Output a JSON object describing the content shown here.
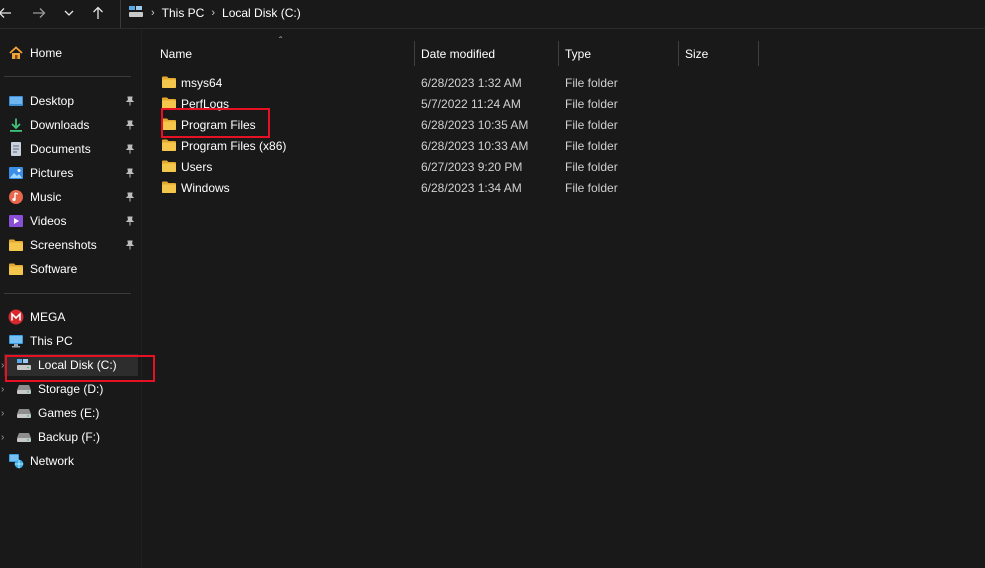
{
  "breadcrumb": [
    "This PC",
    "Local Disk (C:)"
  ],
  "sidebar": {
    "home": "Home",
    "quick_access": [
      {
        "label": "Desktop",
        "icon": "desktop-icon",
        "pinned": true
      },
      {
        "label": "Downloads",
        "icon": "downloads-icon",
        "pinned": true
      },
      {
        "label": "Documents",
        "icon": "documents-icon",
        "pinned": true
      },
      {
        "label": "Pictures",
        "icon": "pictures-icon",
        "pinned": true
      },
      {
        "label": "Music",
        "icon": "music-icon",
        "pinned": true
      },
      {
        "label": "Videos",
        "icon": "videos-icon",
        "pinned": true
      },
      {
        "label": "Screenshots",
        "icon": "folder-icon",
        "pinned": true
      },
      {
        "label": "Software",
        "icon": "folder-icon",
        "pinned": false
      }
    ],
    "locations": [
      {
        "label": "MEGA",
        "icon": "mega-icon"
      },
      {
        "label": "This PC",
        "icon": "this-pc-icon"
      },
      {
        "label": "Local Disk (C:)",
        "icon": "system-drive-icon",
        "selected": true
      },
      {
        "label": "Storage (D:)",
        "icon": "drive-icon"
      },
      {
        "label": "Games (E:)",
        "icon": "drive-icon"
      },
      {
        "label": "Backup (F:)",
        "icon": "drive-icon"
      },
      {
        "label": "Network",
        "icon": "network-icon"
      }
    ]
  },
  "columns": {
    "name": "Name",
    "date": "Date modified",
    "type": "Type",
    "size": "Size"
  },
  "files": [
    {
      "name": "msys64",
      "date": "6/28/2023 1:32 AM",
      "type": "File folder",
      "size": ""
    },
    {
      "name": "PerfLogs",
      "date": "5/7/2022 11:24 AM",
      "type": "File folder",
      "size": ""
    },
    {
      "name": "Program Files",
      "date": "6/28/2023 10:35 AM",
      "type": "File folder",
      "size": ""
    },
    {
      "name": "Program Files (x86)",
      "date": "6/28/2023 10:33 AM",
      "type": "File folder",
      "size": ""
    },
    {
      "name": "Users",
      "date": "6/27/2023 9:20 PM",
      "type": "File folder",
      "size": ""
    },
    {
      "name": "Windows",
      "date": "6/28/2023 1:34 AM",
      "type": "File folder",
      "size": ""
    }
  ],
  "colors": {
    "background": "#191919",
    "selected": "#2d2d2d",
    "highlight_box": "#e81123",
    "folder": "#f4c64c"
  }
}
